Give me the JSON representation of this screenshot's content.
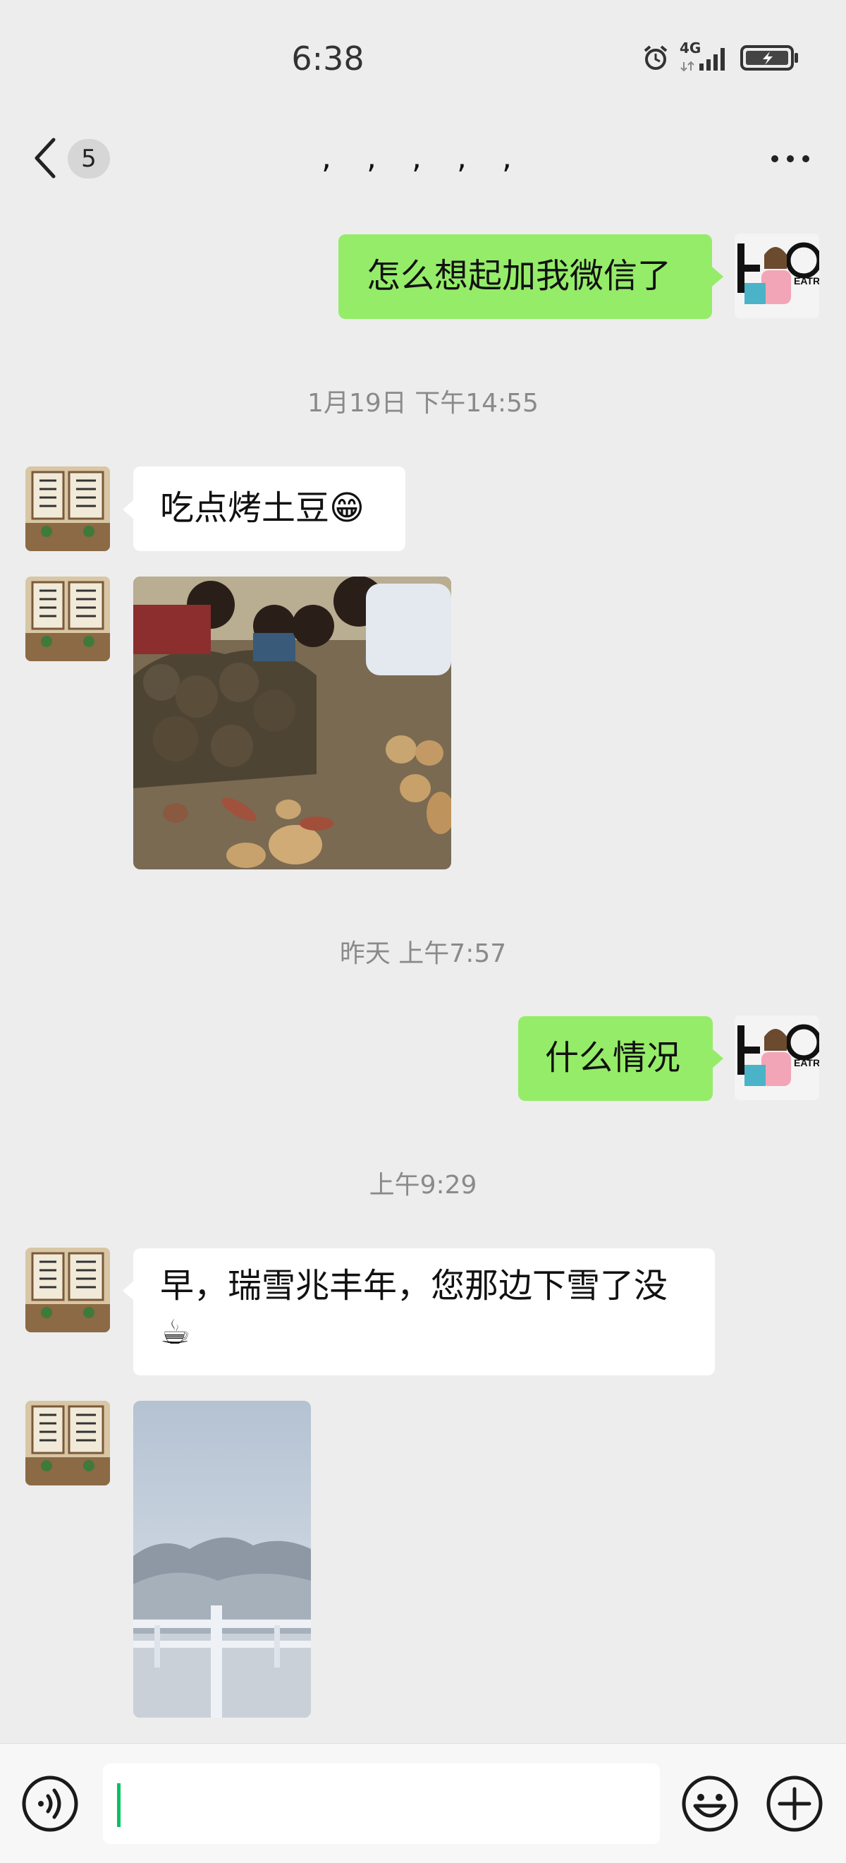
{
  "status_bar": {
    "time": "6:38",
    "network": "4G"
  },
  "nav": {
    "back_count": "5",
    "title": ", , , , ,"
  },
  "messages": [
    {
      "side": "out",
      "text": "怎么想起加我微信了"
    },
    {
      "kind": "timestamp",
      "text": "1月19日 下午14:55"
    },
    {
      "side": "in",
      "text": "吃点烤土豆😁"
    },
    {
      "side": "in",
      "kind": "image",
      "alt": "children roasting potatoes"
    },
    {
      "kind": "timestamp",
      "text": "昨天 上午7:57"
    },
    {
      "side": "out",
      "text": "什么情况"
    },
    {
      "kind": "timestamp",
      "text": "上午9:29"
    },
    {
      "side": "in",
      "text": "早，瑞雪兆丰年，您那边下雪了没",
      "line2": "☕"
    },
    {
      "side": "in",
      "kind": "image",
      "alt": "snowy scene"
    }
  ],
  "input": {
    "placeholder": ""
  },
  "colors": {
    "background": "#ededed",
    "bubble_out": "#95ec69",
    "bubble_in": "#ffffff",
    "cursor": "#07c160"
  }
}
